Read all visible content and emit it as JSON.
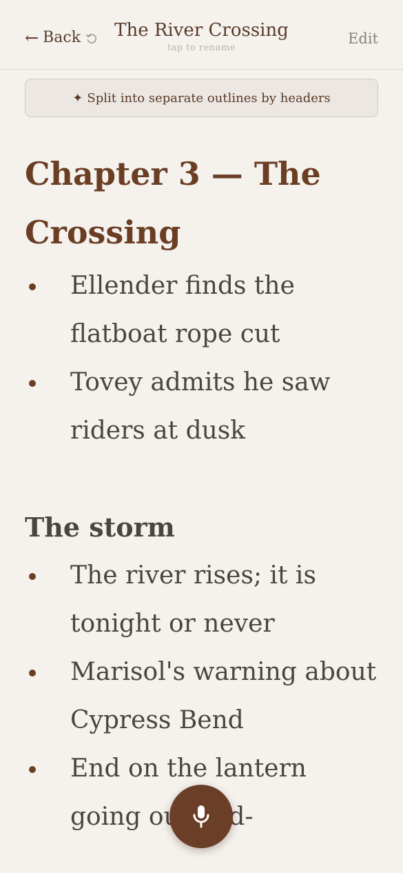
{
  "header": {
    "back_label": "Back",
    "title": "The River Crossing",
    "title_hint": "tap to rename",
    "edit_label": "Edit"
  },
  "split_button": {
    "label": "Split into separate outlines by headers"
  },
  "outline": {
    "sections": [
      {
        "heading": "Chapter 3 — The Crossing",
        "level": 1,
        "items": [
          "Ellender finds the flatboat rope cut",
          "Tovey admits he saw riders at dusk"
        ]
      },
      {
        "heading": "The storm",
        "level": 2,
        "items": [
          "The river rises; it is tonight or never",
          "Marisol's warning about Cypress Bend",
          "End on the lantern going out mid-"
        ]
      }
    ]
  },
  "colors": {
    "background": "#f5f2ee",
    "accent": "#6b3e24",
    "text": "#4a4540",
    "fab": "#6b3e28"
  },
  "icons": {
    "back": "arrow-left-icon",
    "undo": "undo-icon",
    "sparkle": "sparkle-icon",
    "mic": "microphone-icon"
  }
}
